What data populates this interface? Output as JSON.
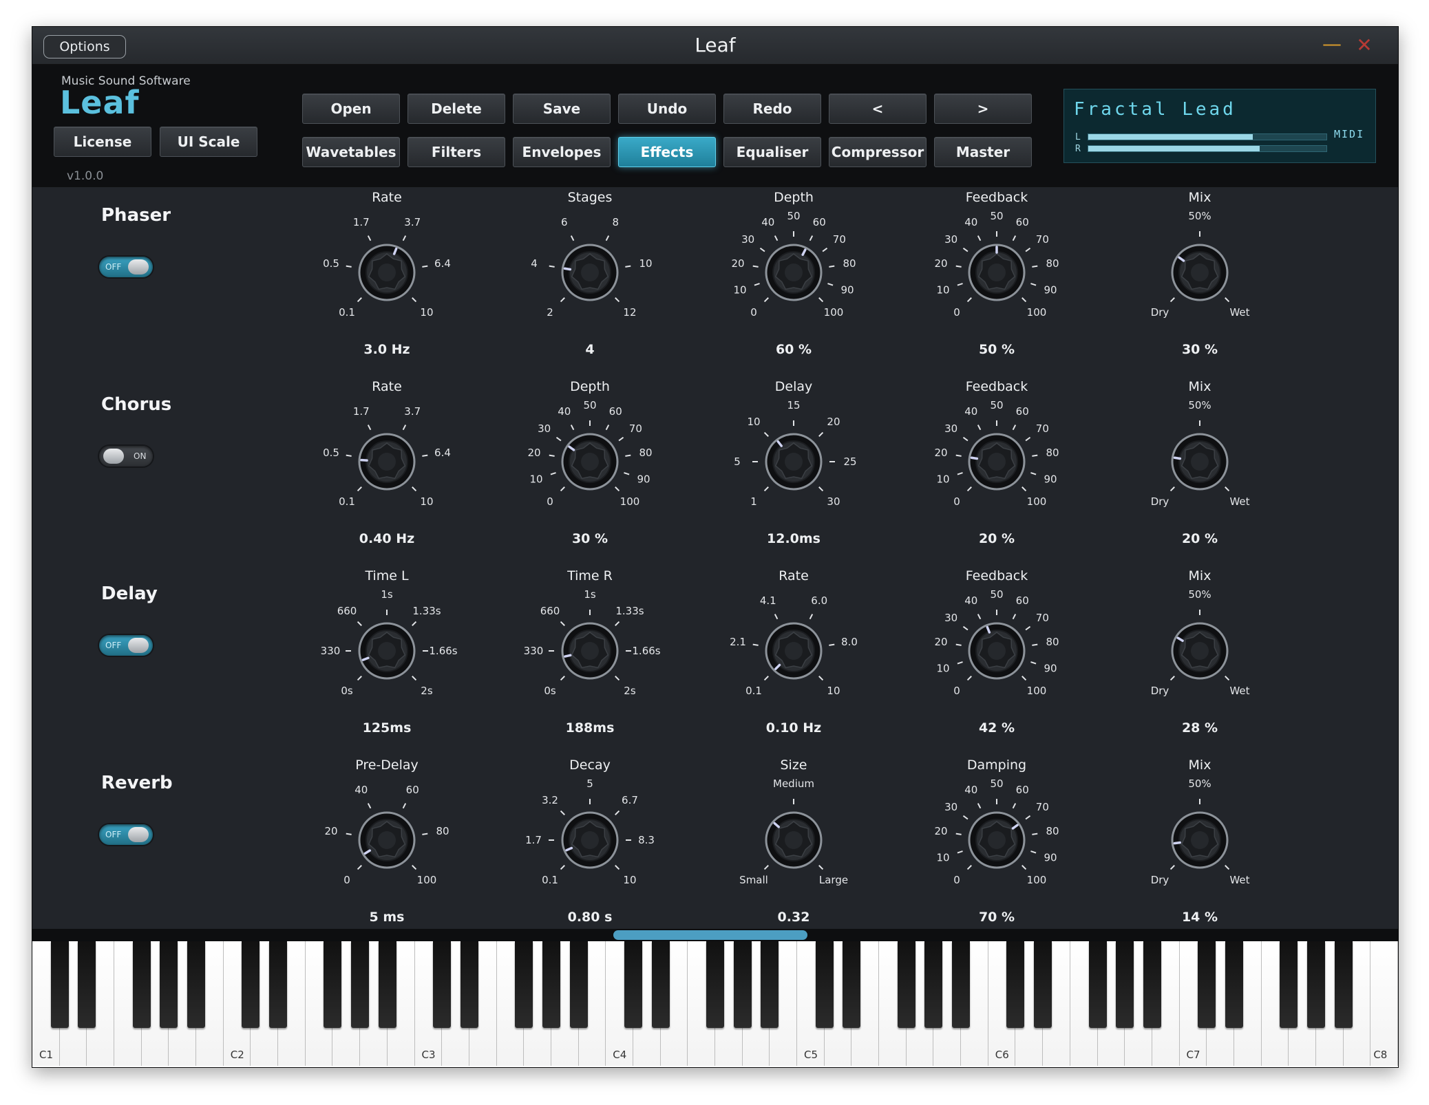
{
  "window": {
    "title": "Leaf",
    "options_label": "Options",
    "minimize_glyph": "—",
    "close_glyph": "✕"
  },
  "brand": {
    "company": "Music Sound Software",
    "logo": "Leaf",
    "version": "v1.0.0"
  },
  "header_buttons": {
    "license": "License",
    "ui_scale": "UI Scale",
    "row1": [
      "Open",
      "Delete",
      "Save",
      "Undo",
      "Redo",
      "<",
      ">"
    ],
    "row2": [
      "Wavetables",
      "Filters",
      "Envelopes",
      "Effects",
      "Equaliser",
      "Compressor",
      "Master"
    ],
    "active_tab": "Effects"
  },
  "display": {
    "preset": "Fractal Lead",
    "midi": "MIDI",
    "meters": [
      {
        "label": "L",
        "level": 0.69
      },
      {
        "label": "R",
        "level": 0.72
      }
    ]
  },
  "sections": [
    {
      "title": "Phaser",
      "toggle": "OFF",
      "knobs": [
        {
          "label": "Rate",
          "value": "3.0 Hz",
          "norm": 0.58,
          "ticks": [
            "0.1",
            "0.5",
            "1.7",
            "3.7",
            "6.4",
            "10"
          ]
        },
        {
          "label": "Stages",
          "value": "4",
          "norm": 0.2,
          "ticks": [
            "2",
            "4",
            "6",
            "8",
            "10",
            "12"
          ]
        },
        {
          "label": "Depth",
          "value": "60 %",
          "norm": 0.6,
          "ticks": [
            "0",
            "10",
            "20",
            "30",
            "40",
            "50",
            "60",
            "70",
            "80",
            "90",
            "100"
          ]
        },
        {
          "label": "Feedback",
          "value": "50 %",
          "norm": 0.5,
          "ticks": [
            "0",
            "10",
            "20",
            "30",
            "40",
            "50",
            "60",
            "70",
            "80",
            "90",
            "100"
          ]
        },
        {
          "label": "Mix",
          "value": "30 %",
          "norm": 0.3,
          "ticks": [
            "Dry",
            "50%",
            "Wet"
          ]
        }
      ]
    },
    {
      "title": "Chorus",
      "toggle": "ON",
      "knobs": [
        {
          "label": "Rate",
          "value": "0.40 Hz",
          "norm": 0.18,
          "ticks": [
            "0.1",
            "0.5",
            "1.7",
            "3.7",
            "6.4",
            "10"
          ]
        },
        {
          "label": "Depth",
          "value": "30 %",
          "norm": 0.3,
          "ticks": [
            "0",
            "10",
            "20",
            "30",
            "40",
            "50",
            "60",
            "70",
            "80",
            "90",
            "100"
          ]
        },
        {
          "label": "Delay",
          "value": "12.0ms",
          "norm": 0.36,
          "ticks": [
            "1",
            "5",
            "10",
            "15",
            "20",
            "25",
            "30"
          ]
        },
        {
          "label": "Feedback",
          "value": "20 %",
          "norm": 0.2,
          "ticks": [
            "0",
            "10",
            "20",
            "30",
            "40",
            "50",
            "60",
            "70",
            "80",
            "90",
            "100"
          ]
        },
        {
          "label": "Mix",
          "value": "20 %",
          "norm": 0.2,
          "ticks": [
            "Dry",
            "50%",
            "Wet"
          ]
        }
      ]
    },
    {
      "title": "Delay",
      "toggle": "OFF",
      "knobs": [
        {
          "label": "Time L",
          "value": "125ms",
          "norm": 0.09,
          "ticks": [
            "0s",
            "330",
            "660",
            "1s",
            "1.33s",
            "1.66s",
            "2s"
          ]
        },
        {
          "label": "Time R",
          "value": "188ms",
          "norm": 0.12,
          "ticks": [
            "0s",
            "330",
            "660",
            "1s",
            "1.33s",
            "1.66s",
            "2s"
          ]
        },
        {
          "label": "Rate",
          "value": "0.10 Hz",
          "norm": 0.0,
          "ticks": [
            "0.1",
            "2.1",
            "4.1",
            "6.0",
            "8.0",
            "10"
          ]
        },
        {
          "label": "Feedback",
          "value": "42 %",
          "norm": 0.42,
          "ticks": [
            "0",
            "10",
            "20",
            "30",
            "40",
            "50",
            "60",
            "70",
            "80",
            "90",
            "100"
          ]
        },
        {
          "label": "Mix",
          "value": "28 %",
          "norm": 0.28,
          "ticks": [
            "Dry",
            "50%",
            "Wet"
          ]
        }
      ]
    },
    {
      "title": "Reverb",
      "toggle": "OFF",
      "knobs": [
        {
          "label": "Pre-Delay",
          "value": "5 ms",
          "norm": 0.05,
          "ticks": [
            "0",
            "20",
            "40",
            "60",
            "80",
            "100"
          ]
        },
        {
          "label": "Decay",
          "value": "0.80 s",
          "norm": 0.08,
          "ticks": [
            "0.1",
            "1.7",
            "3.2",
            "5",
            "6.7",
            "8.3",
            "10"
          ]
        },
        {
          "label": "Size",
          "value": "0.32",
          "norm": 0.32,
          "ticks": [
            "Small",
            "Medium",
            "Large"
          ]
        },
        {
          "label": "Damping",
          "value": "70 %",
          "norm": 0.7,
          "ticks": [
            "0",
            "10",
            "20",
            "30",
            "40",
            "50",
            "60",
            "70",
            "80",
            "90",
            "100"
          ]
        },
        {
          "label": "Mix",
          "value": "14 %",
          "norm": 0.14,
          "ticks": [
            "Dry",
            "50%",
            "Wet"
          ]
        }
      ]
    }
  ],
  "keyboard": {
    "octave_labels": [
      "C1",
      "C2",
      "C3",
      "C4",
      "C5",
      "C6",
      "C7",
      "C8"
    ]
  },
  "colors": {
    "accent": "#3aaac8",
    "panel": "#22252a",
    "display": "#0c2930",
    "close": "#b73a34",
    "minimize": "#d79a2b"
  }
}
